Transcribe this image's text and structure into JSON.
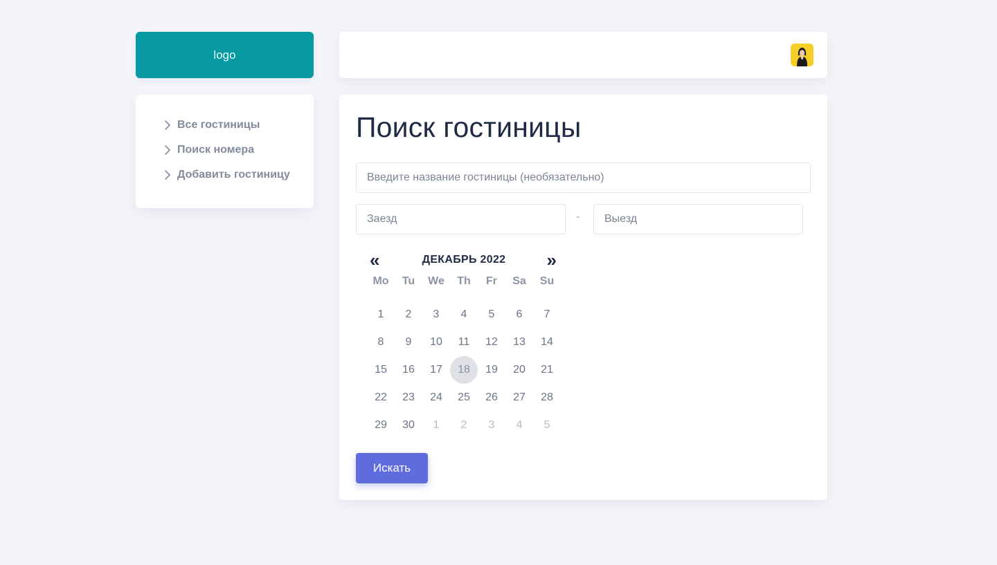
{
  "logo": {
    "text": "logo"
  },
  "sidebar": {
    "items": [
      {
        "label": "Все гостиницы",
        "icon": "chevron-right-icon"
      },
      {
        "label": "Поиск номера",
        "icon": "chevron-right-icon"
      },
      {
        "label": "Добавить гостиницу",
        "icon": "chevron-right-icon"
      }
    ]
  },
  "header": {
    "avatar": "user-avatar"
  },
  "main": {
    "title": "Поиск гостиницы",
    "hotel_placeholder": "Введите название гостиницы (необязательно)",
    "checkin_placeholder": "Заезд",
    "checkout_placeholder": "Выезд",
    "date_separator": "-",
    "search_label": "Искать"
  },
  "calendar": {
    "prev": "«",
    "next": "»",
    "month": "ДЕКАБРЬ 2022",
    "weekdays": [
      "Mo",
      "Tu",
      "We",
      "Th",
      "Fr",
      "Sa",
      "Su"
    ],
    "selected_day": 18,
    "days": [
      {
        "d": "1",
        "other": false
      },
      {
        "d": "2",
        "other": false
      },
      {
        "d": "3",
        "other": false
      },
      {
        "d": "4",
        "other": false
      },
      {
        "d": "5",
        "other": false
      },
      {
        "d": "6",
        "other": false
      },
      {
        "d": "7",
        "other": false
      },
      {
        "d": "8",
        "other": false
      },
      {
        "d": "9",
        "other": false
      },
      {
        "d": "10",
        "other": false
      },
      {
        "d": "11",
        "other": false
      },
      {
        "d": "12",
        "other": false
      },
      {
        "d": "13",
        "other": false
      },
      {
        "d": "14",
        "other": false
      },
      {
        "d": "15",
        "other": false
      },
      {
        "d": "16",
        "other": false
      },
      {
        "d": "17",
        "other": false
      },
      {
        "d": "18",
        "other": false
      },
      {
        "d": "19",
        "other": false
      },
      {
        "d": "20",
        "other": false
      },
      {
        "d": "21",
        "other": false
      },
      {
        "d": "22",
        "other": false
      },
      {
        "d": "23",
        "other": false
      },
      {
        "d": "24",
        "other": false
      },
      {
        "d": "25",
        "other": false
      },
      {
        "d": "26",
        "other": false
      },
      {
        "d": "27",
        "other": false
      },
      {
        "d": "28",
        "other": false
      },
      {
        "d": "29",
        "other": false
      },
      {
        "d": "30",
        "other": false
      },
      {
        "d": "1",
        "other": true
      },
      {
        "d": "2",
        "other": true
      },
      {
        "d": "3",
        "other": true
      },
      {
        "d": "4",
        "other": true
      },
      {
        "d": "5",
        "other": true
      }
    ]
  },
  "colors": {
    "accent": "#079aa3",
    "button": "#5f6cdd",
    "background": "#f4f5fa",
    "title": "#1f2a44",
    "avatar_bg": "#f5cf28"
  }
}
